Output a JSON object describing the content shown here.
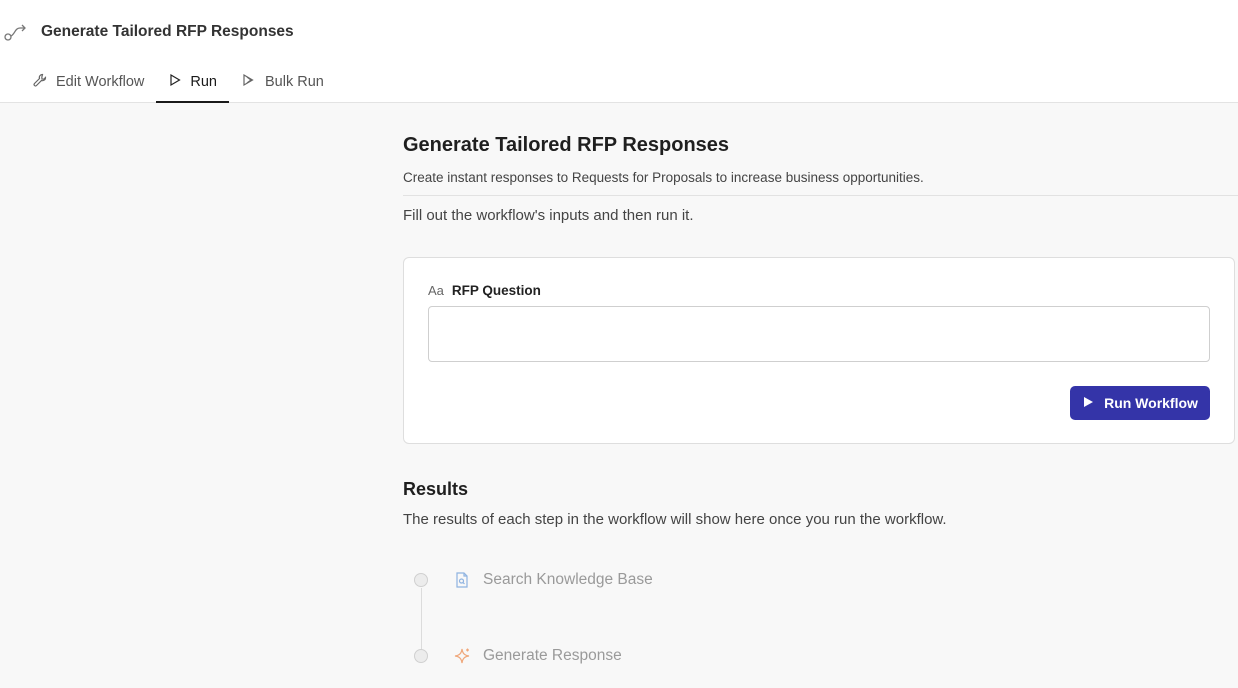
{
  "header": {
    "title": "Generate Tailored RFP Responses",
    "icon": "workflow-icon"
  },
  "tabs": [
    {
      "label": "Edit Workflow",
      "icon": "wrench-icon",
      "active": false
    },
    {
      "label": "Run",
      "icon": "play-icon",
      "active": true
    },
    {
      "label": "Bulk Run",
      "icon": "bulk-play-icon",
      "active": false
    }
  ],
  "main": {
    "title": "Generate Tailored RFP Responses",
    "description": "Create instant responses to Requests for Proposals to increase business opportunities.",
    "instructions": "Fill out the workflow's inputs and then run it."
  },
  "form": {
    "field_type_icon": "Aa",
    "field_label": "RFP Question",
    "field_value": "",
    "run_button_label": "Run Workflow"
  },
  "results": {
    "title": "Results",
    "description": "The results of each step in the workflow will show here once you run the workflow.",
    "steps": [
      {
        "label": "Search Knowledge Base",
        "icon": "document-search-icon"
      },
      {
        "label": "Generate Response",
        "icon": "sparkle-icon"
      }
    ]
  },
  "colors": {
    "accent": "#3434a8",
    "step_search_icon": "#8fb3e0",
    "step_generate_icon": "#f0a77a"
  }
}
